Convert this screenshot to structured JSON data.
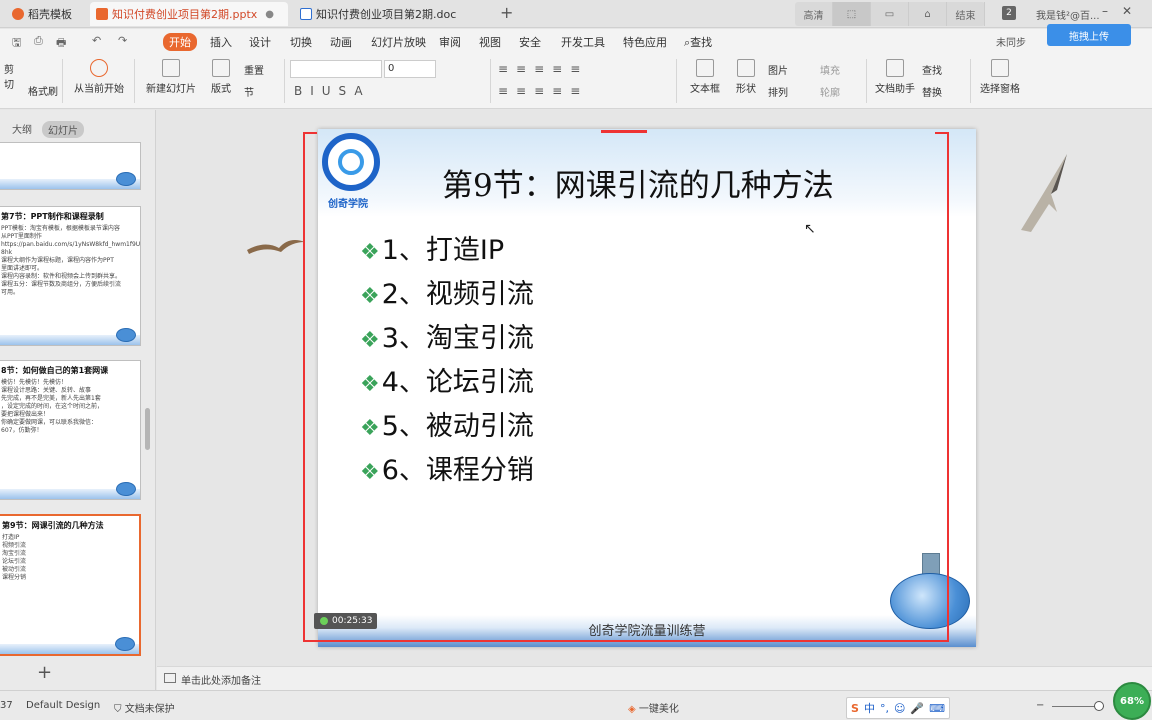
{
  "tabs": [
    {
      "label": "稻壳模板",
      "active": false
    },
    {
      "label": "知识付费创业项目第2期.pptx",
      "active": true
    },
    {
      "label": "知识付费创业项目第2期.doc",
      "active": false
    }
  ],
  "window_buttons": [
    "高清",
    "",
    "",
    "",
    "结束"
  ],
  "tab_count": "2",
  "user_label": "我是钱²@百...",
  "menu": [
    "开始",
    "插入",
    "设计",
    "切换",
    "动画",
    "幻灯片放映",
    "审阅",
    "视图",
    "安全",
    "开发工具",
    "特色应用"
  ],
  "search_label": "查找",
  "sync_label": "未同步",
  "upload_label": "拖拽上传",
  "ribbon": {
    "cut": "剪切",
    "format_painter": "格式刷",
    "play_from_current": "从当前开始",
    "new_slide": "新建幻灯片",
    "layout": "版式",
    "reset": "重置",
    "section": "节",
    "font_size": "0",
    "textbox": "文本框",
    "shape": "形状",
    "picture": "图片",
    "arrange": "排列",
    "fill": "填充",
    "outline": "轮廓",
    "find": "查找",
    "replace": "替换",
    "doc_assistant": "文档助手",
    "select_pane": "选择窗格"
  },
  "left_panel": {
    "outline_tab": "大纲",
    "slides_tab": "幻灯片",
    "thumbs": [
      {
        "title": "",
        "body": ""
      },
      {
        "title": "第7节：PPT制作和课程录制",
        "body": "PPT模板：淘宝有模板，根据模板录节课内容\n从PPT里面制作\nhttps://pan.baidu.com/s/1yNsW8kfd_hwm1f9Un_Zk\n8hk\n课程大纲作为课程标题，课程内容作为PPT\n里面讲述即可。\n课程内容录制：软件和视频会上传到群共享。\n课程五分：课程节数及商组分，方便后续引流\n可用。"
      },
      {
        "title": "8节：如何做自己的第1套网课",
        "body": "模仿！先模仿！先模仿！\n课程设计思路：关键、反转、故事\n先完成，再不是完美，新人先出第1套\n，设定完成的时间，在这个时间之前，\n要把课程做出来！\n你确定要做网课，可以联系我微信：\n607，仿勤弥！"
      },
      {
        "title": "第9节：网课引流的几种方法",
        "body": "打造IP\n视频引流\n淘宝引流\n论坛引流\n被动引流\n课程分销"
      }
    ]
  },
  "slide": {
    "logo_text": "创奇学院",
    "title": "第9节：网课引流的几种方法",
    "bullets": [
      "1、打造IP",
      "2、视频引流",
      "3、淘宝引流",
      "4、论坛引流",
      "5、被动引流",
      "6、课程分销"
    ],
    "footer": "创奇学院流量训练营",
    "timer": "00:25:33"
  },
  "notes_placeholder": "单击此处添加备注",
  "status": {
    "slide_no": "37",
    "design": "Default Design",
    "protection": "文档未保护",
    "beautify": "一键美化",
    "zoom": "68%"
  },
  "colors": {
    "accent": "#e9682f",
    "bullet": "#3aa35a",
    "frame": "#e33333"
  }
}
